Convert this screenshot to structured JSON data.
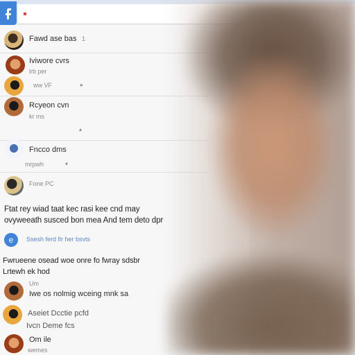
{
  "feed": {
    "items": [
      {
        "name": "Fawd ase bas",
        "meta": "1"
      },
      {
        "name": "Iviwore cvrs",
        "meta": "lrb per"
      },
      {
        "name": "",
        "meta": "ww  VF"
      },
      {
        "name": "Rcyeon cvn",
        "meta": "kr  ms"
      },
      {
        "name": "Fncco dms",
        "meta": "mrpwh"
      },
      {
        "name": "",
        "meta": "Fone  PC"
      }
    ],
    "post": {
      "line1": "Ftat rey wiad taat kec rasi kee cnd may",
      "line2": "ovyweeath susced bon mea And tem deto dpr"
    },
    "link": {
      "icon_letter": "e",
      "text": "Ssesh ferd fir her bsvts"
    },
    "comments": {
      "header": "Fwrueene osead woe onre fo fwray sdsbr",
      "subheader": "Lrtewh ek hod",
      "items": [
        {
          "name": "Um",
          "text": "Iwe os nolmig wceing mnk sa"
        },
        {
          "name": "",
          "text": "Aseiet Dcctie pcfd"
        },
        {
          "name": "",
          "text": "Ivcn Deme fcs"
        },
        {
          "name": "Om ile",
          "text": "wemes"
        }
      ]
    }
  },
  "colors": {
    "accent": "#3f84d8",
    "red_mark": "#d9463e"
  }
}
